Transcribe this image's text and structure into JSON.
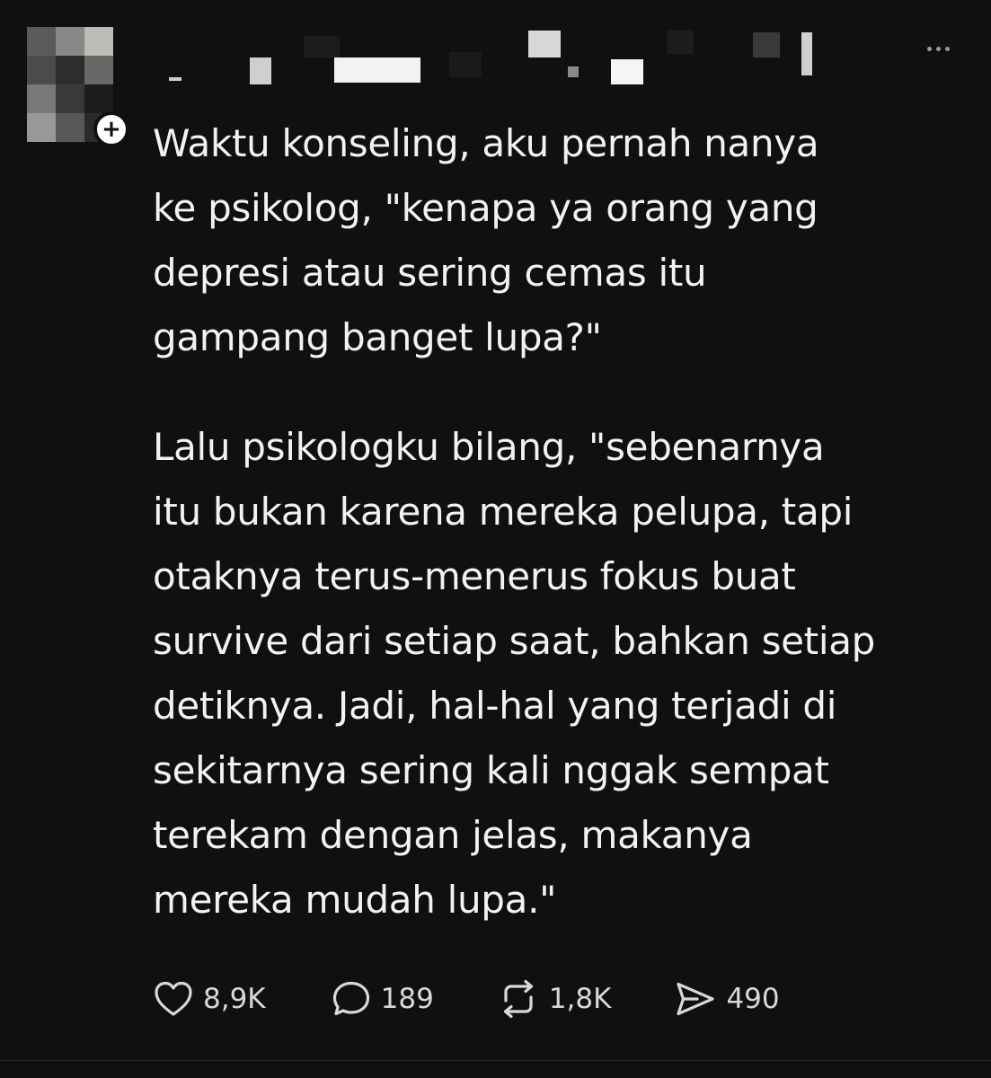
{
  "post": {
    "author_name": "",
    "follow_label": "+",
    "paragraphs": [
      "Waktu konseling, aku pernah nanya\nke psikolog, \"kenapa ya orang yang\ndepresi atau sering cemas itu\ngampang banget lupa?\"",
      "Lalu psikologku bilang, \"sebenarnya\nitu bukan karena mereka pelupa, tapi\notaknya terus-menerus fokus buat\nsurvive dari setiap saat, bahkan setiap\ndetiknya. Jadi, hal-hal yang terjadi di\nsekitarnya sering kali nggak sempat\nterekam dengan jelas, makanya\nmereka mudah lupa.\""
    ]
  },
  "actions": {
    "like": {
      "icon": "heart-icon",
      "count": "8,9K"
    },
    "reply": {
      "icon": "comment-icon",
      "count": "189"
    },
    "repost": {
      "icon": "repost-icon",
      "count": "1,8K"
    },
    "share": {
      "icon": "send-icon",
      "count": "490"
    }
  },
  "colors": {
    "background": "#101010",
    "text": "#f2f2f2",
    "icon": "#d8d8d8"
  }
}
